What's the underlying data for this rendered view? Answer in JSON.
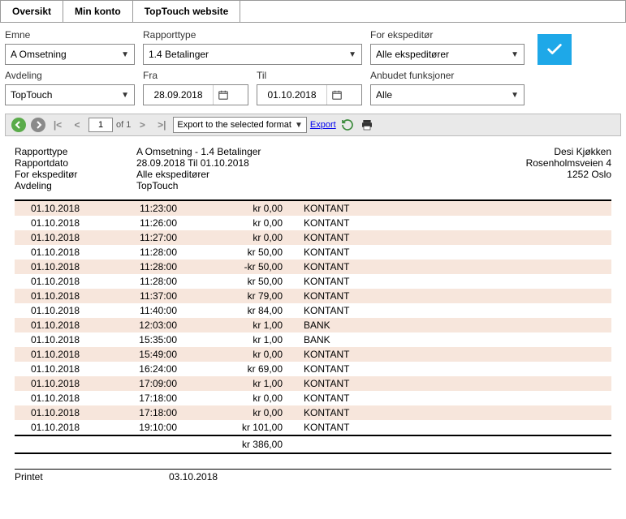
{
  "tabs": [
    "Oversikt",
    "Min konto",
    "TopTouch website"
  ],
  "filters": {
    "emne": {
      "label": "Emne",
      "value": "A Omsetning"
    },
    "rapporttype": {
      "label": "Rapporttype",
      "value": "1.4 Betalinger"
    },
    "ekspeditor": {
      "label": "For ekspeditør",
      "value": "Alle ekspeditører"
    },
    "avdeling": {
      "label": "Avdeling",
      "value": "TopTouch"
    },
    "fra": {
      "label": "Fra",
      "value": "28.09.2018"
    },
    "til": {
      "label": "Til",
      "value": "01.10.2018"
    },
    "anbudet": {
      "label": "Anbudet funksjoner",
      "value": "Alle"
    }
  },
  "toolbar": {
    "page": "1",
    "of_label": "of 1",
    "export_select": "Export to the selected format",
    "export_link": "Export"
  },
  "report": {
    "meta": [
      {
        "label": "Rapporttype",
        "value": "A Omsetning - 1.4 Betalinger"
      },
      {
        "label": "Rapportdato",
        "value": "28.09.2018 Til 01.10.2018"
      },
      {
        "label": "For ekspeditør",
        "value": "Alle ekspeditører"
      },
      {
        "label": "Avdeling",
        "value": "TopTouch"
      }
    ],
    "address": [
      "Desi Kjøkken",
      "Rosenholmsveien 4",
      "1252 Oslo"
    ],
    "rows": [
      {
        "date": "01.10.2018",
        "time": "11:23:00",
        "amount": "kr 0,00",
        "type": "KONTANT"
      },
      {
        "date": "01.10.2018",
        "time": "11:26:00",
        "amount": "kr 0,00",
        "type": "KONTANT"
      },
      {
        "date": "01.10.2018",
        "time": "11:27:00",
        "amount": "kr 0,00",
        "type": "KONTANT"
      },
      {
        "date": "01.10.2018",
        "time": "11:28:00",
        "amount": "kr 50,00",
        "type": "KONTANT"
      },
      {
        "date": "01.10.2018",
        "time": "11:28:00",
        "amount": "-kr 50,00",
        "type": "KONTANT"
      },
      {
        "date": "01.10.2018",
        "time": "11:28:00",
        "amount": "kr 50,00",
        "type": "KONTANT"
      },
      {
        "date": "01.10.2018",
        "time": "11:37:00",
        "amount": "kr 79,00",
        "type": "KONTANT"
      },
      {
        "date": "01.10.2018",
        "time": "11:40:00",
        "amount": "kr 84,00",
        "type": "KONTANT"
      },
      {
        "date": "01.10.2018",
        "time": "12:03:00",
        "amount": "kr 1,00",
        "type": "BANK"
      },
      {
        "date": "01.10.2018",
        "time": "15:35:00",
        "amount": "kr 1,00",
        "type": "BANK"
      },
      {
        "date": "01.10.2018",
        "time": "15:49:00",
        "amount": "kr 0,00",
        "type": "KONTANT"
      },
      {
        "date": "01.10.2018",
        "time": "16:24:00",
        "amount": "kr 69,00",
        "type": "KONTANT"
      },
      {
        "date": "01.10.2018",
        "time": "17:09:00",
        "amount": "kr 1,00",
        "type": "KONTANT"
      },
      {
        "date": "01.10.2018",
        "time": "17:18:00",
        "amount": "kr 0,00",
        "type": "KONTANT"
      },
      {
        "date": "01.10.2018",
        "time": "17:18:00",
        "amount": "kr 0,00",
        "type": "KONTANT"
      },
      {
        "date": "01.10.2018",
        "time": "19:10:00",
        "amount": "kr 101,00",
        "type": "KONTANT"
      }
    ],
    "total": "kr 386,00",
    "printed_label": "Printet",
    "printed_date": "03.10.2018"
  }
}
